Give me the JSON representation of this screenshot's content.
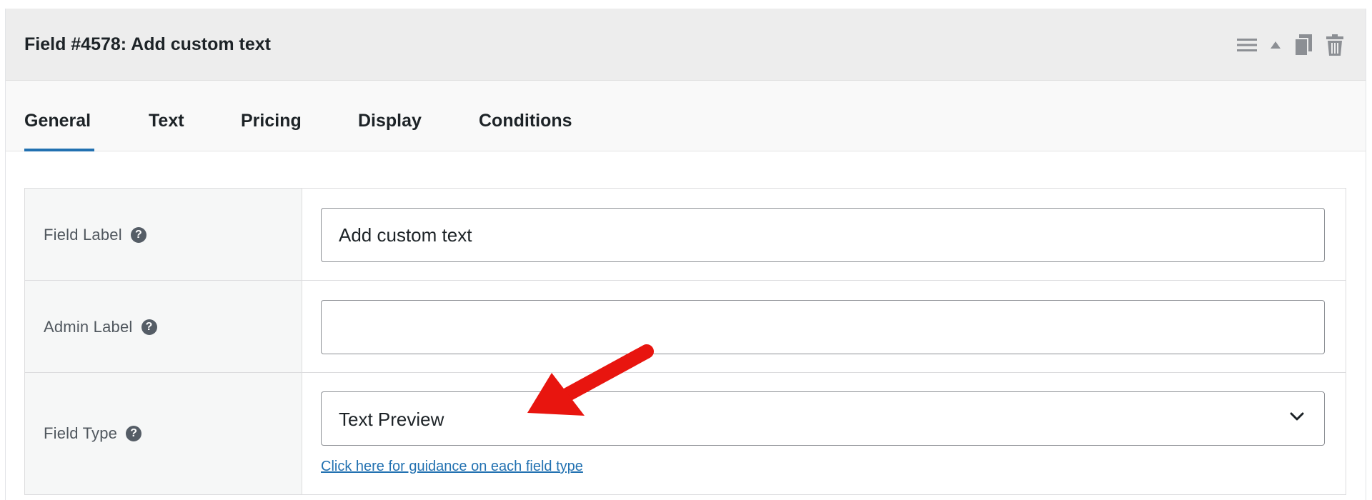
{
  "header": {
    "title": "Field #4578: Add custom text",
    "icons": [
      "menu-icon",
      "collapse-arrow-icon",
      "duplicate-icon",
      "trash-icon"
    ]
  },
  "tabs": [
    {
      "label": "General",
      "active": true
    },
    {
      "label": "Text",
      "active": false
    },
    {
      "label": "Pricing",
      "active": false
    },
    {
      "label": "Display",
      "active": false
    },
    {
      "label": "Conditions",
      "active": false
    }
  ],
  "form": {
    "field_label": {
      "label": "Field Label",
      "value": "Add custom text",
      "help_icon": "?"
    },
    "admin_label": {
      "label": "Admin Label",
      "value": "",
      "help_icon": "?"
    },
    "field_type": {
      "label": "Field Type",
      "selected": "Text Preview",
      "help_icon": "?",
      "guidance_link": "Click here for guidance on each field type"
    }
  },
  "colors": {
    "accent": "#2271b1",
    "header_bg": "#ededed",
    "arrow": "#e8150f",
    "help_icon_bg": "#555d66"
  }
}
